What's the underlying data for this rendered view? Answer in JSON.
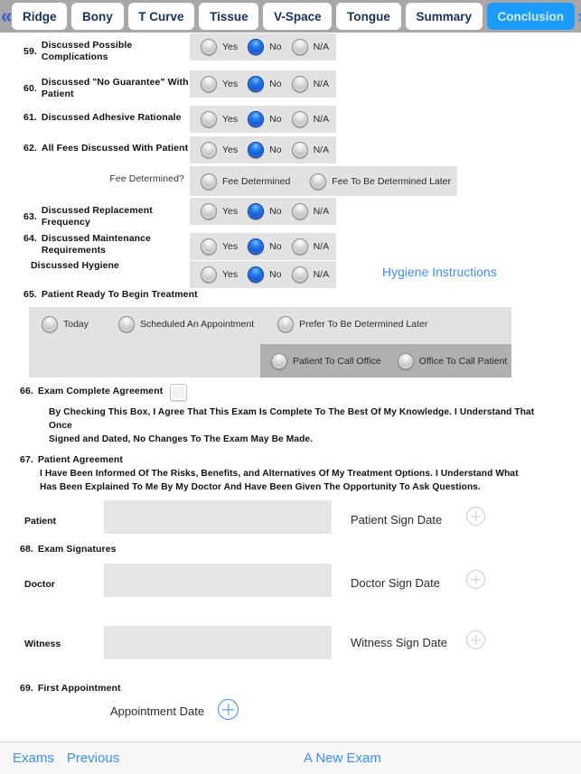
{
  "tabbar": {
    "prev_icon": "chevron-double-left-icon",
    "next_icon": "chevron-double-right-icon",
    "prev_glyph": "«",
    "next_glyph": "»",
    "tabs": [
      {
        "label": "Ridge",
        "active": false
      },
      {
        "label": "Bony",
        "active": false
      },
      {
        "label": "T Curve",
        "active": false
      },
      {
        "label": "Tissue",
        "active": false
      },
      {
        "label": "V-Space",
        "active": false
      },
      {
        "label": "Tongue",
        "active": false
      },
      {
        "label": "Summary",
        "active": false
      },
      {
        "label": "Conclusion",
        "active": true
      }
    ]
  },
  "colors": {
    "accent_blue": "#3d8df5",
    "tab_active_bg": "#1d9bfd",
    "radio_selected": "#0b4fd0",
    "row_bg": "#e2e2e2",
    "row_bg_dark": "#b0b0b0",
    "tabbar_bg": "#a8a8a8"
  },
  "questions": {
    "q59": {
      "number": "59.",
      "label": "Discussed Possible Complications",
      "options": [
        {
          "label": "Yes",
          "selected": false
        },
        {
          "label": "No",
          "selected": true
        },
        {
          "label": "N/A",
          "selected": false
        }
      ]
    },
    "q60": {
      "number": "60.",
      "label": "Discussed \"No Guarantee\" With Patient",
      "options": [
        {
          "label": "Yes",
          "selected": false
        },
        {
          "label": "No",
          "selected": true
        },
        {
          "label": "N/A",
          "selected": false
        }
      ]
    },
    "q61": {
      "number": "61.",
      "label": "Discussed Adhesive Rationale",
      "options": [
        {
          "label": "Yes",
          "selected": false
        },
        {
          "label": "No",
          "selected": true
        },
        {
          "label": "N/A",
          "selected": false
        }
      ]
    },
    "q62": {
      "number": "62.",
      "label": "All Fees Discussed With Patient",
      "options": [
        {
          "label": "Yes",
          "selected": false
        },
        {
          "label": "No",
          "selected": true
        },
        {
          "label": "N/A",
          "selected": false
        }
      ],
      "sub_label": "Fee Determined?",
      "sub_options": [
        {
          "label": "Fee Determined",
          "selected": false
        },
        {
          "label": "Fee To Be Determined Later",
          "selected": false
        }
      ]
    },
    "q63": {
      "number": "63.",
      "label": "Discussed Replacement Frequency",
      "options": [
        {
          "label": "Yes",
          "selected": false
        },
        {
          "label": "No",
          "selected": true
        },
        {
          "label": "N/A",
          "selected": false
        }
      ]
    },
    "q64": {
      "number": "64.",
      "label_line1": "Discussed Maintenance",
      "label_line2": "Requirements",
      "options": [
        {
          "label": "Yes",
          "selected": false
        },
        {
          "label": "No",
          "selected": true
        },
        {
          "label": "N/A",
          "selected": false
        }
      ],
      "sub_label": "Discussed Hygiene",
      "sub_options": [
        {
          "label": "Yes",
          "selected": false
        },
        {
          "label": "No",
          "selected": true
        },
        {
          "label": "N/A",
          "selected": false
        }
      ],
      "link_label": "Hygiene Instructions"
    },
    "q65": {
      "number": "65.",
      "label": "Patient Ready To Begin Treatment",
      "options": [
        {
          "label": "Today",
          "selected": false
        },
        {
          "label": "Scheduled An Appointment",
          "selected": false
        },
        {
          "label": "Prefer To Be Determined Later",
          "selected": false
        }
      ],
      "nested_options": [
        {
          "label": "Patient To Call Office",
          "selected": false
        },
        {
          "label": "Office To Call Patient",
          "selected": false
        }
      ]
    },
    "q66": {
      "number": "66.",
      "label": "Exam Complete  Agreement",
      "checked": false,
      "body_line1": "By Checking This Box, I Agree That This Exam Is Complete To The Best Of My Knowledge.  I Understand That Once",
      "body_line2": "Signed and Dated, No Changes To The Exam May Be Made."
    },
    "q67": {
      "number": "67.",
      "label": "Patient Agreement",
      "body_line1": "I Have Been Informed Of The Risks, Benefits, and Alternatives Of My Treatment Options.  I Understand What",
      "body_line2": "Has Been Explained To Me By My Doctor And Have Been Given The Opportunity To Ask Questions.",
      "sig_label": "Patient",
      "sig_value": "",
      "date_label": "Patient Sign Date",
      "add_icon": "plus-circle-icon"
    },
    "q68": {
      "number": "68.",
      "label": "Exam Signatures",
      "rows": [
        {
          "sig_label": "Doctor",
          "sig_value": "",
          "date_label": "Doctor Sign Date",
          "add_icon": "plus-circle-icon"
        },
        {
          "sig_label": "Witness",
          "sig_value": "",
          "date_label": "Witness Sign Date",
          "add_icon": "plus-circle-icon"
        }
      ]
    },
    "q69": {
      "number": "69.",
      "label": "First Appointment",
      "date_label": "Appointment Date",
      "add_icon": "plus-circle-icon"
    }
  },
  "bottombar": {
    "exams_label": "Exams",
    "previous_label": "Previous",
    "new_exam_label": "A New Exam"
  }
}
